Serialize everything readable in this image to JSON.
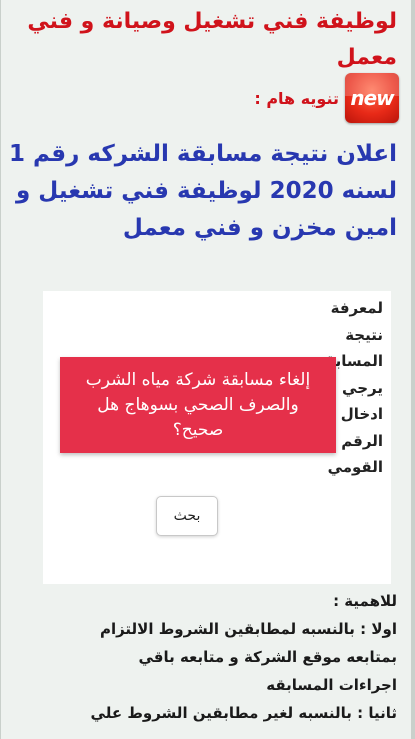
{
  "top_title": "لوظيفة فني تشغيل وصيانة و فني معمل",
  "notice": {
    "badge_text": "new",
    "label": "تنويه هام :"
  },
  "headline": "اعلان نتيجة مسابقة الشركه رقم 1 لسنه 2020 لوظيفة فني تشغيل و امين مخزن و فني معمل",
  "form": {
    "label_lines": [
      "لمعرفة",
      "نتيجة",
      "المسابقة",
      "يرجي",
      "ادخال",
      "الرقم",
      "القومي"
    ],
    "search_button_label": "بحث"
  },
  "overlay": {
    "text": "إلغاء مسابقة شركة مياه الشرب والصرف الصحي بسوهاج هل صحيح؟"
  },
  "importance": {
    "title": "للاهمية :",
    "lines": [
      "اولا : بالنسبه لمطابقين الشروط الالتزام",
      "بمتابعه موقع الشركة و متابعه باقي",
      "اجراءات المسابقه",
      "ثانيا : بالنسبه لغير مطابقين الشروط علي"
    ]
  },
  "colors": {
    "title_red": "#d0131b",
    "headline_blue": "#2838b0",
    "overlay_red": "#e5304a"
  }
}
